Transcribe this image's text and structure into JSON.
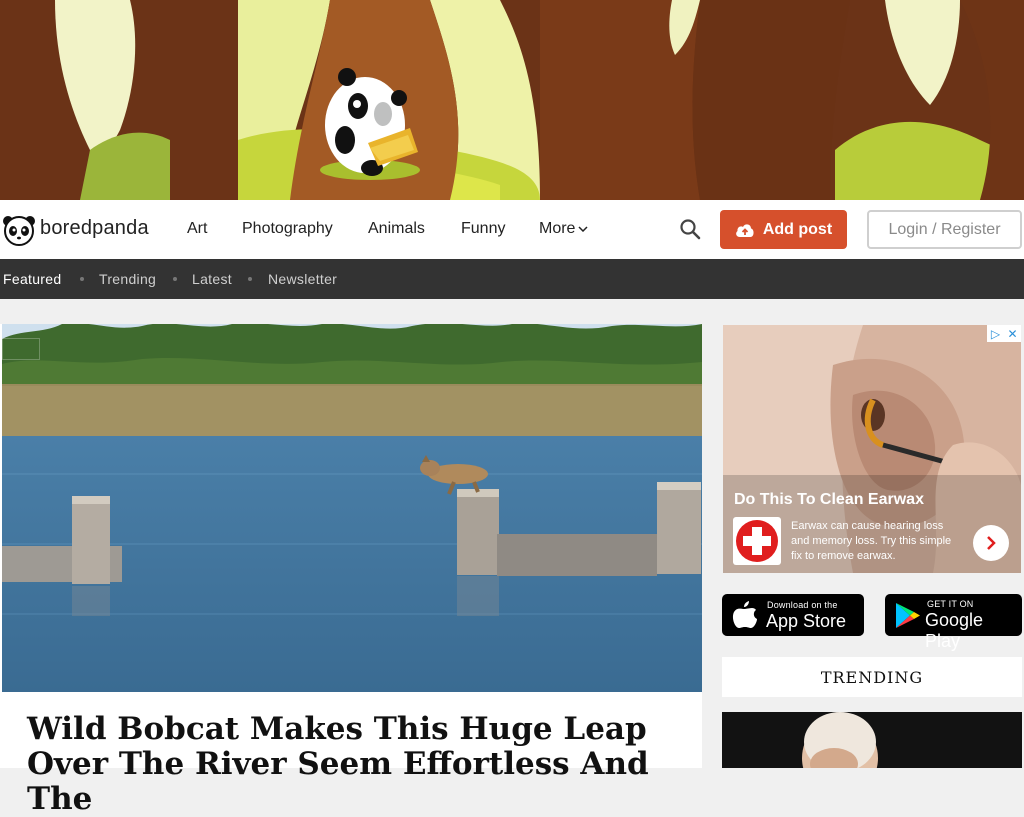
{
  "brand": {
    "name": "boredpanda"
  },
  "nav": {
    "links": [
      {
        "label": "Art"
      },
      {
        "label": "Photography"
      },
      {
        "label": "Animals"
      },
      {
        "label": "Funny"
      },
      {
        "label": "More"
      }
    ],
    "add_post_label": "Add post",
    "login_label": "Login / Register"
  },
  "subnav": {
    "items": [
      {
        "label": "Featured",
        "active": true
      },
      {
        "label": "Trending"
      },
      {
        "label": "Latest"
      },
      {
        "label": "Newsletter"
      }
    ]
  },
  "article": {
    "title": "Wild Bobcat Makes This Huge Leap Over The River Seem Effortless And The"
  },
  "ad": {
    "title": "Do This To Clean Earwax",
    "text": "Earwax can cause hearing loss and memory loss. Try this simple fix to remove earwax."
  },
  "app_badges": {
    "apple": {
      "small": "Download on the",
      "big": "App Store"
    },
    "google": {
      "small": "GET IT ON",
      "big": "Google Play"
    }
  },
  "trending": {
    "header": "TRENDING"
  },
  "colors": {
    "accent": "#d6502c",
    "subnav_bg": "#333333",
    "page_bg": "#f0f0f0"
  }
}
